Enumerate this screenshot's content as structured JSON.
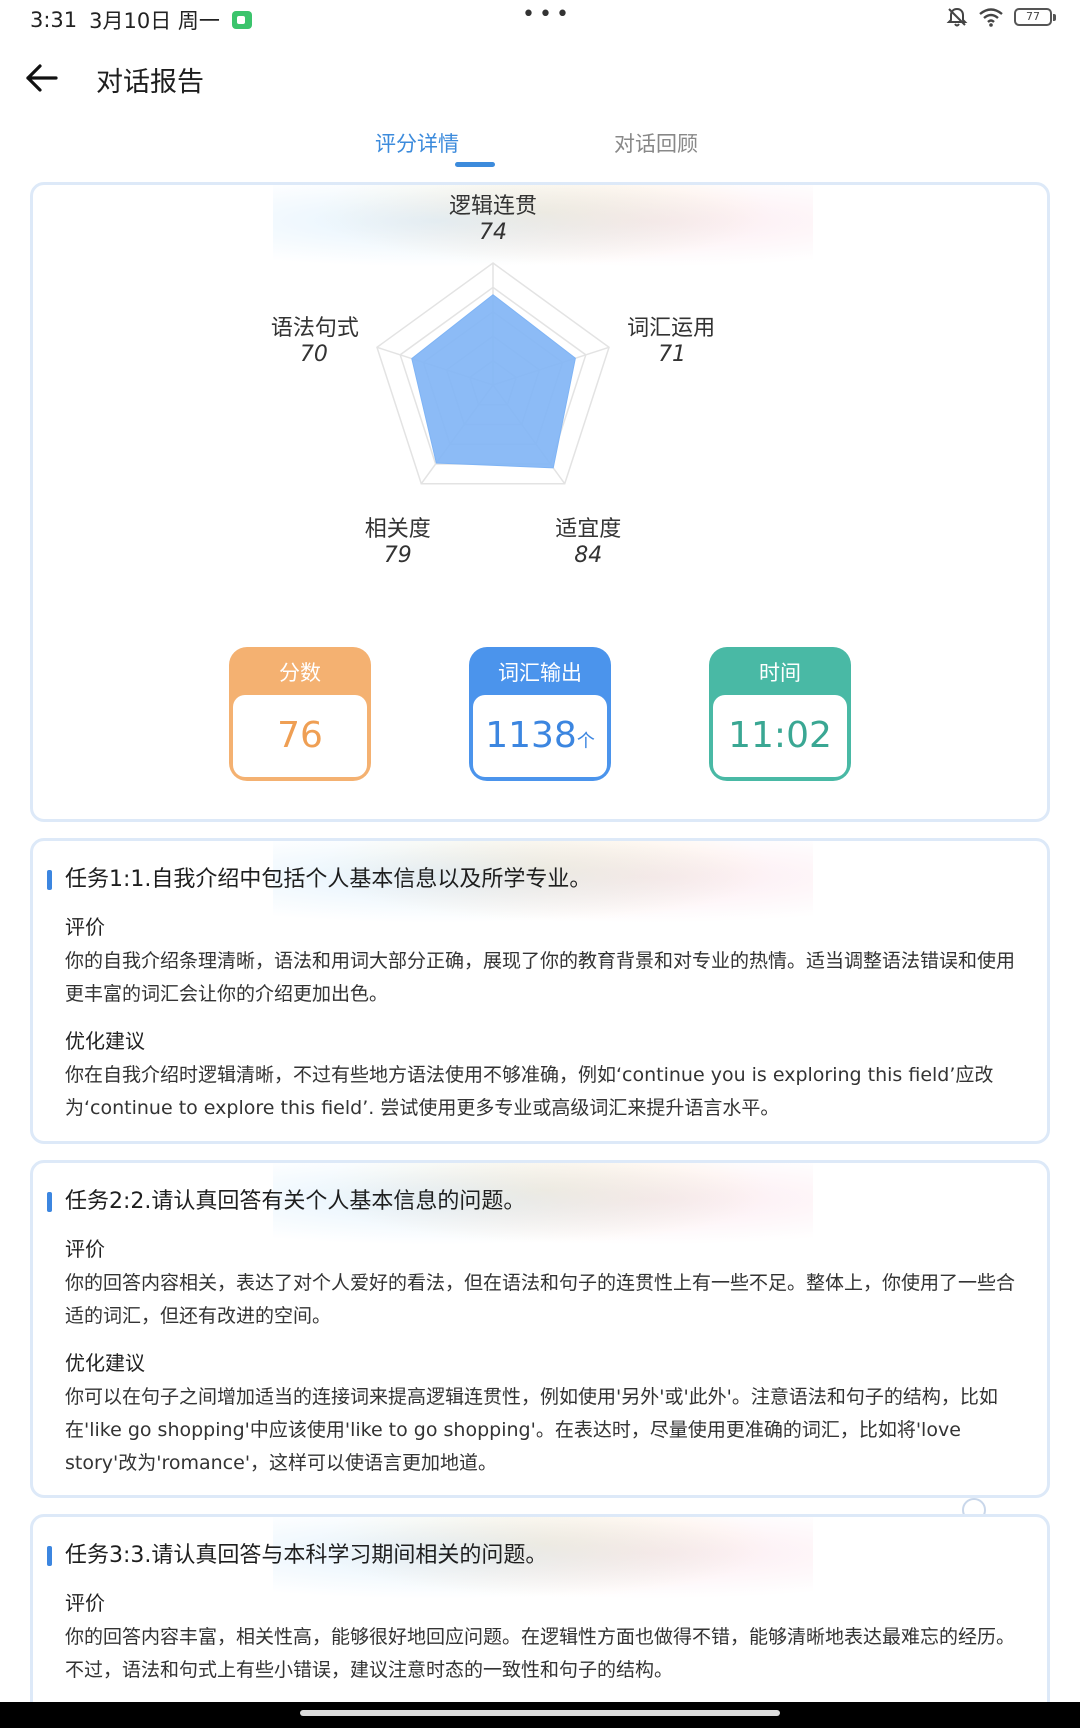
{
  "status_bar": {
    "time": "3:31",
    "date": "3月10日 周一",
    "dots": "•••",
    "battery": "77",
    "icons": [
      "app-icon",
      "mute-icon",
      "wifi-icon",
      "battery-icon"
    ]
  },
  "header": {
    "title": "对话报告",
    "back_icon": "arrow-left-icon"
  },
  "tabs": [
    {
      "label": "评分详情",
      "active": true
    },
    {
      "label": "对话回顾",
      "active": false
    }
  ],
  "radar": {
    "axes": [
      {
        "label": "逻辑连贯",
        "value": "74"
      },
      {
        "label": "词汇运用",
        "value": "71"
      },
      {
        "label": "适宜度",
        "value": "84"
      },
      {
        "label": "相关度",
        "value": "79"
      },
      {
        "label": "语法句式",
        "value": "70"
      }
    ],
    "max": 100,
    "fill_color": "#7fb4f5"
  },
  "stats": {
    "score": {
      "label": "分数",
      "value": "76"
    },
    "vocab": {
      "label": "词汇输出",
      "value": "1138",
      "unit": "个"
    },
    "time": {
      "label": "时间",
      "value": "11:02"
    }
  },
  "tasks": [
    {
      "title": "任务1:1.自我介绍中包括个人基本信息以及所学专业。",
      "eval_label": "评价",
      "eval_text": "你的自我介绍条理清晰，语法和用词大部分正确，展现了你的教育背景和对专业的热情。适当调整语法错误和使用更丰富的词汇会让你的介绍更加出色。",
      "suggest_label": "优化建议",
      "suggest_text": "你在自我介绍时逻辑清晰，不过有些地方语法使用不够准确，例如‘continue you is exploring this field’应改为‘continue to explore this field’. 尝试使用更多专业或高级词汇来提升语言水平。"
    },
    {
      "title": "任务2:2.请认真回答有关个人基本信息的问题。",
      "eval_label": "评价",
      "eval_text": "你的回答内容相关，表达了对个人爱好的看法，但在语法和句子的连贯性上有一些不足。整体上，你使用了一些合适的词汇，但还有改进的空间。",
      "suggest_label": "优化建议",
      "suggest_text": "你可以在句子之间增加适当的连接词来提高逻辑连贯性，例如使用'另外'或'此外'。注意语法和句子的结构，比如在'like go shopping'中应该使用'like to go shopping'。在表达时，尽量使用更准确的词汇，比如将'love story'改为'romance'，这样可以使语言更加地道。"
    },
    {
      "title": "任务3:3.请认真回答与本科学习期间相关的问题。",
      "eval_label": "评价",
      "eval_text": "你的回答内容丰富，相关性高，能够很好地回应问题。在逻辑性方面也做得不错，能够清晰地表达最难忘的经历。不过，语法和句式上有些小错误，建议注意时态的一致性和句子的结构。"
    }
  ]
}
